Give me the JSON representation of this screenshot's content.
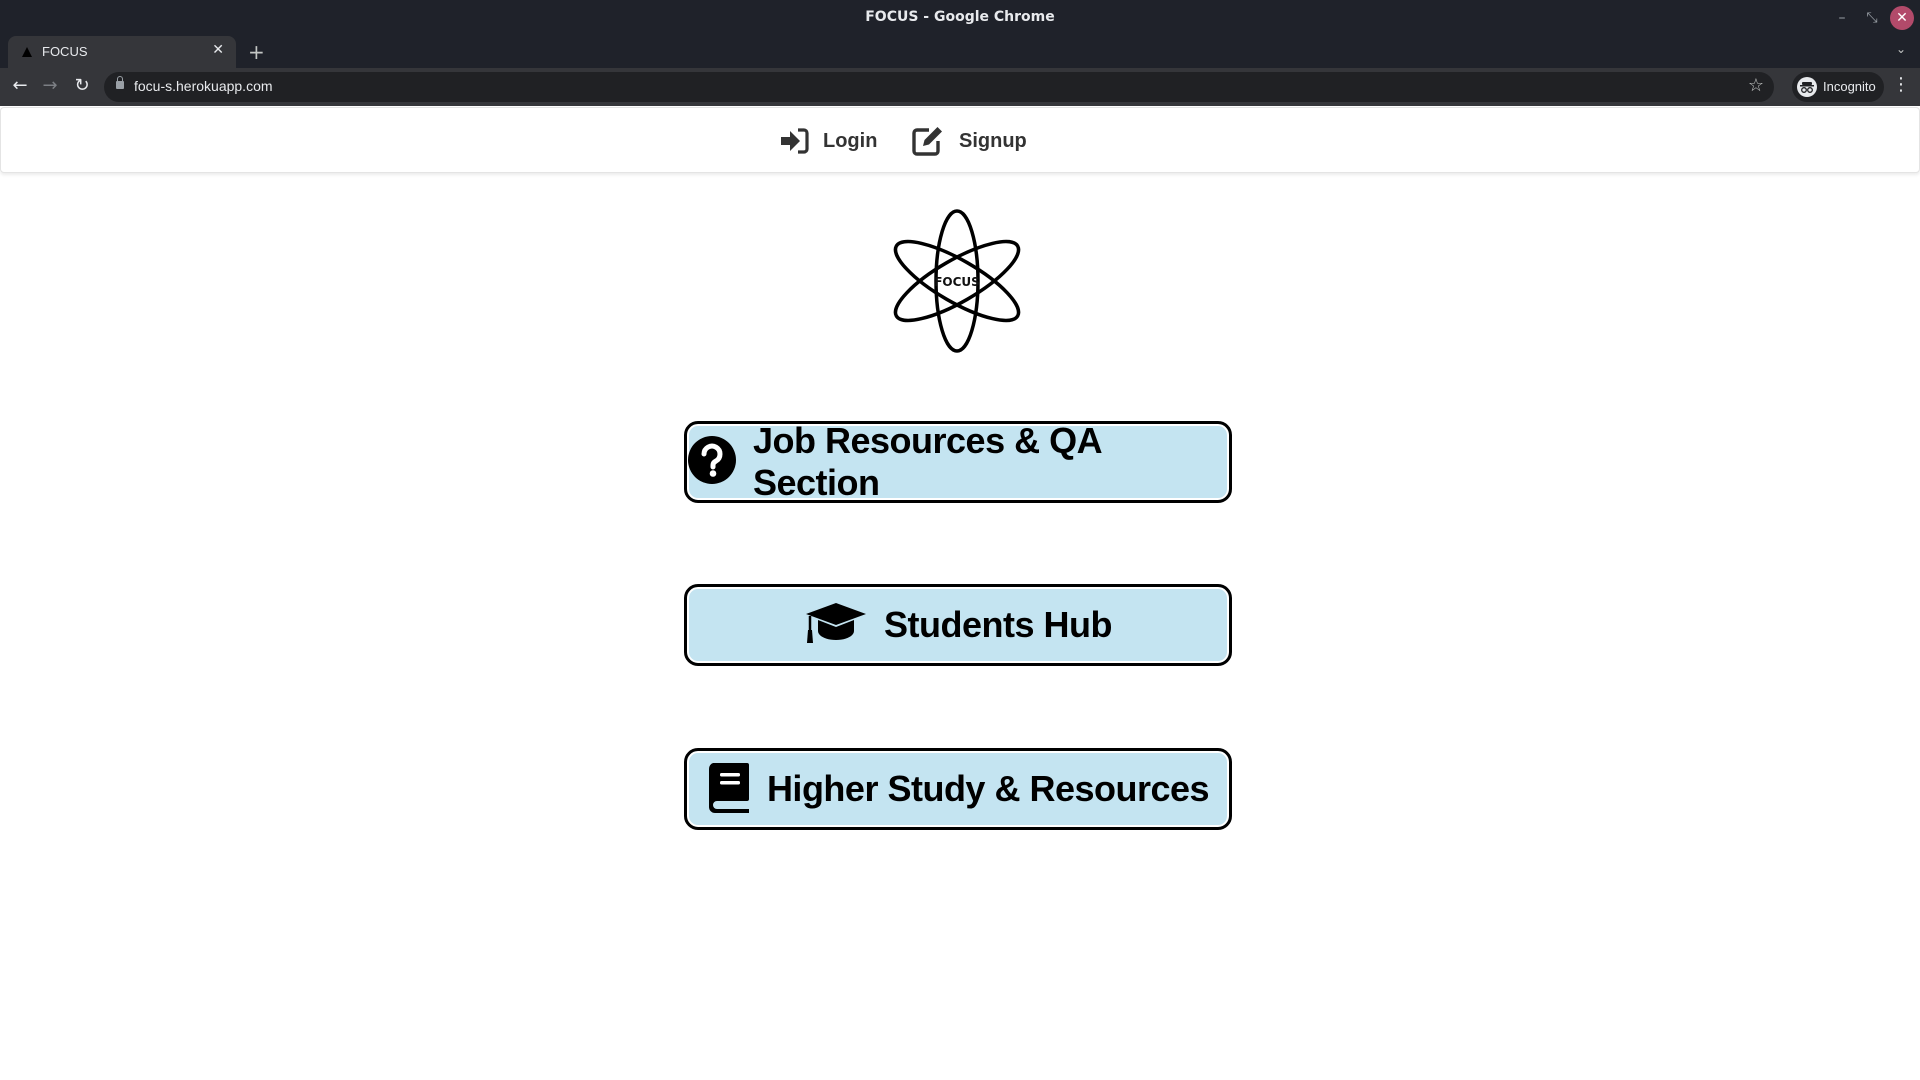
{
  "window": {
    "title": "FOCUS - Google Chrome",
    "controls": {
      "minimize": "–",
      "restore": "⤡",
      "close": "✕"
    }
  },
  "browser": {
    "tab": {
      "title": "FOCUS",
      "close": "✕"
    },
    "new_tab": "+",
    "tab_menu": "⌄",
    "nav": {
      "back": "←",
      "forward": "→",
      "reload": "↻"
    },
    "url": "focu-s.herokuapp.com",
    "bookmark_star": "☆",
    "profile_label": "Incognito",
    "profile_icon": "👓",
    "menu": "⋮"
  },
  "site": {
    "navbar": {
      "login_label": "Login",
      "signup_label": "Signup"
    },
    "logo_text": "FOCUS",
    "sections": [
      {
        "label": "Job Resources & QA Section",
        "icon": "question-circle-icon"
      },
      {
        "label": "Students Hub",
        "icon": "graduation-cap-icon"
      },
      {
        "label": "Higher Study & Resources",
        "icon": "book-icon"
      }
    ],
    "colors": {
      "button_bg": "#c4e4f1",
      "button_border": "#000000"
    }
  }
}
